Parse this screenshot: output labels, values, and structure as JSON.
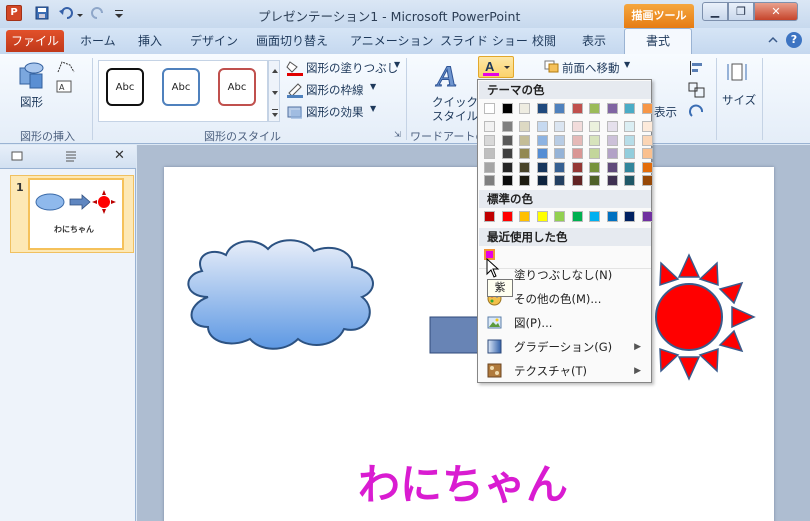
{
  "titlebar": {
    "title": "プレゼンテーション1 - Microsoft PowerPoint",
    "tool_tab": "描画ツール",
    "app_icon": "P"
  },
  "tabs": {
    "file": "ファイル",
    "home": "ホーム",
    "insert": "挿入",
    "design": "デザイン",
    "transitions": "画面切り替え",
    "animations": "アニメーション",
    "slideshow": "スライド ショー",
    "review": "校閲",
    "view": "表示",
    "format": "書式"
  },
  "ribbon": {
    "insert_shapes": {
      "shapes_label": "図形",
      "group_label": "図形の挿入"
    },
    "shape_styles": {
      "style1": "Abc",
      "style2": "Abc",
      "style3": "Abc",
      "fill_label": "図形の塗りつぶし",
      "outline_label": "図形の枠線",
      "effects_label": "図形の効果",
      "group_label": "図形のスタイル"
    },
    "wordart": {
      "quick_style_label1": "クイック",
      "quick_style_label2": "スタイル",
      "group_label": "ワードアートのス"
    },
    "arrange": {
      "bring_forward": "前面へ移動",
      "display_label": "表示"
    },
    "size": {
      "label": "サイズ"
    }
  },
  "slide_pane": {
    "slide_number": "1",
    "thumb_text": "わにちゃん"
  },
  "slide": {
    "title_text": "わにちゃん",
    "title_color": "#d91cd1"
  },
  "dropdown": {
    "theme_colors_header": "テーマの色",
    "standard_colors_header": "標準の色",
    "recent_colors_header": "最近使用した色",
    "no_fill": "塗りつぶしなし(N)",
    "more_colors": "その他の色(M)...",
    "picture": "図(P)...",
    "gradient": "グラデーション(G)",
    "texture": "テクスチャ(T)",
    "tooltip": "紫",
    "theme_top": [
      "#ffffff",
      "#000000",
      "#eeece1",
      "#1f497d",
      "#4f81bd",
      "#c0504d",
      "#9bbb59",
      "#8064a2",
      "#4bacc6",
      "#f79646"
    ],
    "theme_shades": [
      [
        "#f2f2f2",
        "#7f7f7f",
        "#ddd9c3",
        "#c6d9f0",
        "#dbe5f1",
        "#f2dcdb",
        "#ebf1dd",
        "#e5e0ec",
        "#dbeef3",
        "#fdeada"
      ],
      [
        "#d8d8d8",
        "#595959",
        "#c4bd97",
        "#8db3e2",
        "#b8cce4",
        "#e5b9b7",
        "#d7e3bc",
        "#ccc1d9",
        "#b7dde8",
        "#fbd5b5"
      ],
      [
        "#bfbfbf",
        "#3f3f3f",
        "#938953",
        "#548dd4",
        "#95b3d7",
        "#d99694",
        "#c3d69b",
        "#b2a2c7",
        "#92cddc",
        "#fac08f"
      ],
      [
        "#a5a5a5",
        "#262626",
        "#494429",
        "#17365d",
        "#366092",
        "#953734",
        "#76923c",
        "#5f497a",
        "#31859b",
        "#e36c09"
      ],
      [
        "#7f7f7f",
        "#0c0c0c",
        "#1d1b10",
        "#0f243e",
        "#244061",
        "#632423",
        "#4f6128",
        "#3f3151",
        "#205867",
        "#974806"
      ]
    ],
    "standard": [
      "#c00000",
      "#ff0000",
      "#ffc000",
      "#ffff00",
      "#92d050",
      "#00b050",
      "#00b0f0",
      "#0070c0",
      "#002060",
      "#7030a0"
    ],
    "recent": [
      "#e600e6"
    ]
  }
}
